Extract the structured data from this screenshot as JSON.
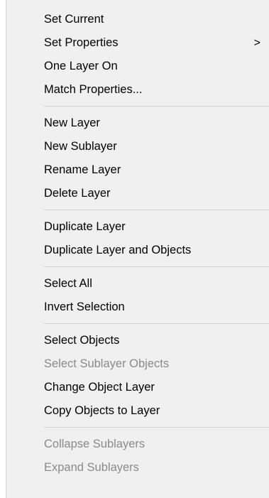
{
  "menu": {
    "groups": [
      {
        "items": [
          {
            "label": "Set Current",
            "enabled": true
          },
          {
            "label": "Set Properties",
            "enabled": true,
            "submenu_arrow": ">"
          },
          {
            "label": "One Layer On",
            "enabled": true
          },
          {
            "label": "Match Properties...",
            "enabled": true
          }
        ]
      },
      {
        "items": [
          {
            "label": "New Layer",
            "enabled": true
          },
          {
            "label": "New Sublayer",
            "enabled": true
          },
          {
            "label": "Rename Layer",
            "enabled": true
          },
          {
            "label": "Delete Layer",
            "enabled": true
          }
        ]
      },
      {
        "items": [
          {
            "label": "Duplicate Layer",
            "enabled": true
          },
          {
            "label": "Duplicate Layer and Objects",
            "enabled": true
          }
        ]
      },
      {
        "items": [
          {
            "label": "Select All",
            "enabled": true
          },
          {
            "label": "Invert Selection",
            "enabled": true
          }
        ]
      },
      {
        "items": [
          {
            "label": "Select Objects",
            "enabled": true
          },
          {
            "label": "Select Sublayer Objects",
            "enabled": false
          },
          {
            "label": "Change Object Layer",
            "enabled": true
          },
          {
            "label": "Copy Objects to Layer",
            "enabled": true
          }
        ]
      },
      {
        "items": [
          {
            "label": "Collapse Sublayers",
            "enabled": false
          },
          {
            "label": "Expand Sublayers",
            "enabled": false
          }
        ]
      }
    ],
    "colors": {
      "background": "#f0f0f0",
      "text": "#000000",
      "disabled_text": "#8a8a8a",
      "separator": "#d2d2d2"
    }
  }
}
